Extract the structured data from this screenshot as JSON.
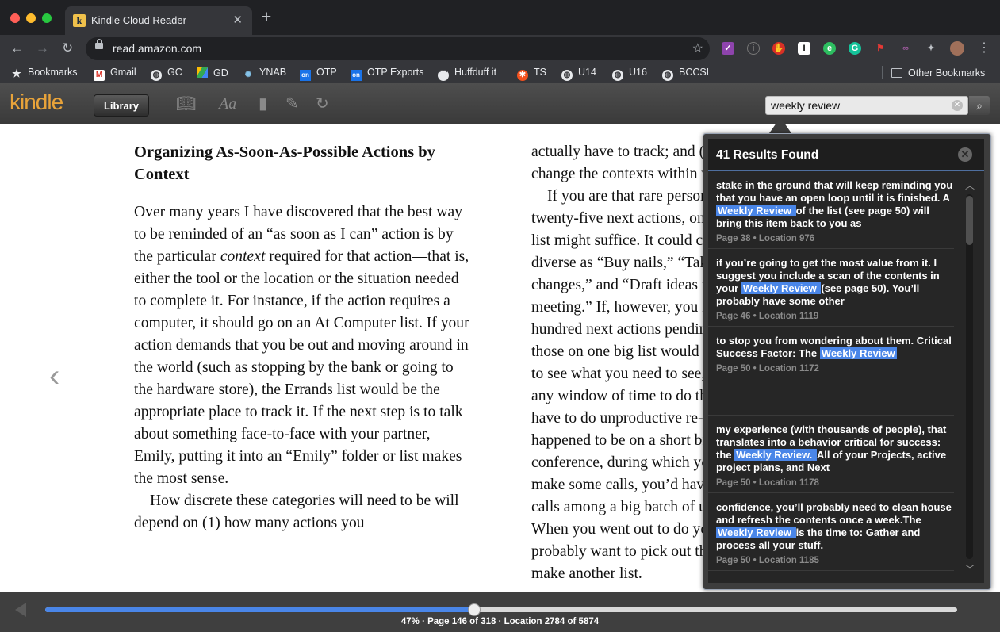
{
  "browser": {
    "tab_title": "Kindle Cloud Reader",
    "url": "read.amazon.com",
    "bookmarks": [
      {
        "label": "Bookmarks",
        "icon": "star-icon"
      },
      {
        "label": "Gmail",
        "icon": "gmail-icon"
      },
      {
        "label": "GC",
        "icon": "globe-icon"
      },
      {
        "label": "GD",
        "icon": "google-drive-icon"
      },
      {
        "label": "YNAB",
        "icon": "ynab-icon"
      },
      {
        "label": "OTP",
        "icon": "otp-icon"
      },
      {
        "label": "OTP Exports",
        "icon": "otp-icon"
      },
      {
        "label": "Huffduff it",
        "icon": "huffduffer-icon"
      },
      {
        "label": "TS",
        "icon": "ts-icon"
      },
      {
        "label": "U14",
        "icon": "globe-icon"
      },
      {
        "label": "U16",
        "icon": "globe-icon"
      },
      {
        "label": "BCCSL",
        "icon": "globe-icon"
      }
    ],
    "other_bookmarks": "Other Bookmarks"
  },
  "kindle": {
    "logo": "kindle",
    "library_label": "Library",
    "search_value": "weekly review"
  },
  "book": {
    "heading": "Organizing As-Soon-As-Possible Actions by Context",
    "left_para1": "Over many years I have discovered that the best way to be reminded of an “as soon as I can” action is by the particular ",
    "left_para1_em": "context",
    "left_para1_rest": " required for that action—that is, either the tool or the location or the situation needed to complete it. For instance, if the action requires a computer, it should go on an At Computer list. If your action demands that you be out and moving around in the world (such as stopping by the bank or going to the hardware store), the Errands list would be the appropriate place to track it. If the next step is to talk about something face-to-face with your partner, Emily, putting it into an “Emily” folder or list makes the most sense.",
    "left_para2": "How discrete these categories will need to be will depend on (1) how many actions you",
    "right_lines": [
      "actually have to track; and (2) how often you",
      "change the contexts within which you work.",
      "If you are that rare person who has only",
      "twenty-five next actions, one such list",
      "list might suffice. It could contain things as",
      "diverse as “Buy nails,” “Take dog for shots,”",
      "changes,” and “Draft ideas for the staff",
      "meeting.” If, however, you have several",
      "hundred next actions pending, keeping all",
      "those on one big list would make it difficult",
      "to see what you need to see, when you have",
      "any window of time to do things; you would",
      "have to do unproductive re-sorting. If you",
      "happened to be on a short break at a",
      "conference, during which you could",
      "make some calls, you’d have to pick out your",
      "calls among a big batch of undifferentiated items.",
      "When you went out to do your errands, you would",
      "probably want to pick out those items and",
      "make another list."
    ]
  },
  "search_panel": {
    "title": "41 Results Found",
    "results": [
      {
        "pre": "stake in the ground that will keep reminding you that you have an open loop until it is finished. A ",
        "hit": "Weekly Review ",
        "post": "of the list (see page 50) will bring this item back to you as",
        "loc": "Page 38 • Location 976"
      },
      {
        "pre": "if you’re going to get the most value from it. I suggest you include a scan of the contents in your ",
        "hit": "Weekly Review ",
        "post": "(see page 50). You’ll probably have some other",
        "loc": "Page 46 • Location 1119"
      },
      {
        "pre": "to stop you from wondering about them. Critical Success Factor: The ",
        "hit": "Weekly Review",
        "post": "",
        "loc": "Page 50 • Location 1172"
      },
      {
        "pre": "my experience (with thousands of people), that translates into a behavior critical for success: the ",
        "hit": "Weekly Review. ",
        "post": "All of your Projects, active project plans, and Next",
        "loc": "Page 50 • Location 1178"
      },
      {
        "pre": "confidence, you’ll probably need to clean house and refresh the contents once a week.The ",
        "hit": "Weekly Review ",
        "post": "is the time to: Gather and process all your stuff.",
        "loc": "Page 50 • Location 1185"
      }
    ]
  },
  "progress": {
    "percent": 47,
    "status_text": "47% · Page 146 of 318 · Location 2784 of 5874"
  },
  "colors": {
    "accent": "#4a86e8",
    "kindle_logo": "#e8a33a",
    "chrome_dark": "#202124",
    "chrome_mid": "#35363a"
  }
}
